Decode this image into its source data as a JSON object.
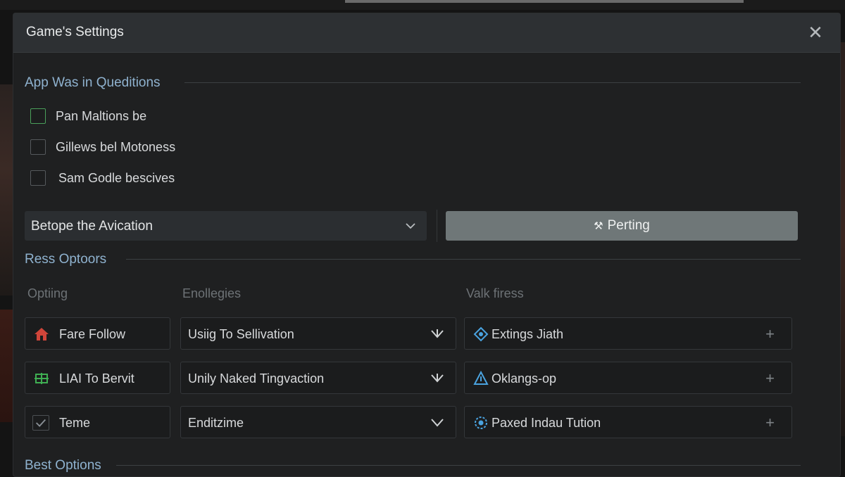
{
  "dialog": {
    "title": "Game's Settings",
    "close_glyph": "✕"
  },
  "section1": {
    "heading": "App Was in Queditions",
    "checks": [
      {
        "label": "Pan Maltions be",
        "checked": false
      },
      {
        "label": "Gillews bel Motoness",
        "checked": false
      },
      {
        "label": "Sam Godle bescives",
        "checked": false
      }
    ],
    "dropdown": "Betope the Avication",
    "button": "Perting"
  },
  "section2": {
    "heading": "Ress Optoors",
    "columns": [
      "Optiing",
      "Enollegies",
      "Valk firess"
    ],
    "rows": [
      {
        "option": "Fare Follow",
        "option_icon": "house-icon",
        "option_color": "#d0453a",
        "select": "Usiig To Sellivation",
        "value": "Extings Jiath",
        "value_icon": "diamond-icon"
      },
      {
        "option": "LIAI To Bervit",
        "option_icon": "grid-icon",
        "option_color": "#3fae52",
        "select": "Unily Naked Tingvaction",
        "value": "Oklangs-op",
        "value_icon": "triangle-icon"
      },
      {
        "option": "Teme",
        "option_icon": "check-icon",
        "option_color": "#8a9096",
        "select": "Enditzime",
        "value": "Paxed Indau Tution",
        "value_icon": "gear-icon"
      }
    ]
  },
  "section3": {
    "heading": "Best Options"
  },
  "colors": {
    "accent_blue": "#8fb2cf",
    "icon_blue": "#4aa3e0",
    "button_gray": "#6f7778"
  }
}
